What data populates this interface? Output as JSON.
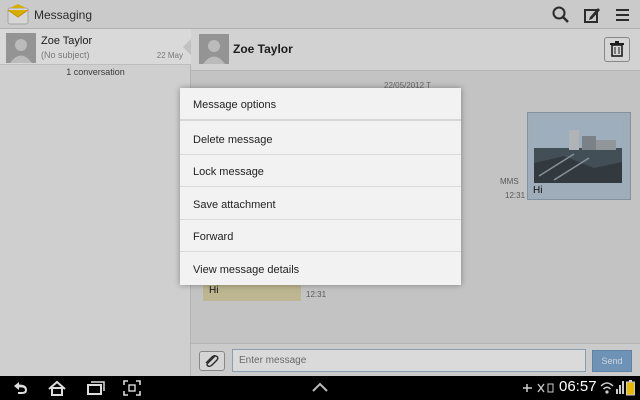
{
  "app": {
    "title": "Messaging"
  },
  "colors": {
    "accent": "#7fa8d1",
    "incoming_bubble": "#d8d0a4",
    "mms_bubble": "#b5c4d3"
  },
  "action_bar": {
    "icons": [
      "search-icon",
      "compose-icon",
      "menu-icon"
    ]
  },
  "conversation_list": {
    "items": [
      {
        "name": "Zoe Taylor",
        "subject": "(No subject)",
        "date": "22 May"
      }
    ],
    "count_label": "1 conversation"
  },
  "chat": {
    "contact_name": "Zoe Taylor",
    "date_separator": "22/05/2012 T",
    "messages": [
      {
        "direction": "outgoing",
        "type_label": "MMS",
        "text": "Hi",
        "time": "12:31"
      },
      {
        "direction": "incoming",
        "text": "Hi",
        "time": "12:31"
      }
    ],
    "composer": {
      "placeholder": "Enter message",
      "send_label": "Send"
    }
  },
  "context_menu": {
    "title": "Message options",
    "items": [
      "Delete message",
      "Lock message",
      "Save attachment",
      "Forward",
      "View message details"
    ]
  },
  "system_bar": {
    "time": "06:57"
  }
}
